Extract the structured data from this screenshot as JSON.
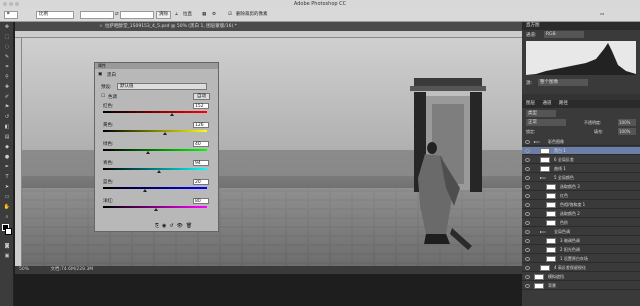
{
  "app_title": "Adobe Photoshop CC",
  "options_bar": {
    "mode_label": "比例",
    "clear_label": "清除",
    "straighten_label": "拉直",
    "delete_crop_label": "删除裁剪的像素"
  },
  "document_tab": "拉萨晒醇堂_1S09153_4_5.psd @ 50% (黑白 1, 图层蒙版/16) *",
  "status": {
    "zoom": "50%",
    "doc_size": "文档:74.6M/228.3M"
  },
  "properties": {
    "title": "属性",
    "adjust_name": "黑白",
    "preset_label": "预设:",
    "preset_value": "默认值",
    "tint_label": "色调",
    "auto_label": "自动",
    "sliders": [
      {
        "label": "红色:",
        "value": "152",
        "level": 0.66
      },
      {
        "label": "黄色:",
        "value": "126",
        "level": 0.6
      },
      {
        "label": "绿色:",
        "value": "40",
        "level": 0.43
      },
      {
        "label": "青色:",
        "value": "94",
        "level": 0.54
      },
      {
        "label": "蓝色:",
        "value": "20",
        "level": 0.4
      },
      {
        "label": "洋红:",
        "value": "80",
        "level": 0.51
      }
    ]
  },
  "histogram": {
    "title": "直方图",
    "channel_label": "通道:",
    "channel_value": "RGB",
    "source_label": "源:",
    "source_value": "整个图像"
  },
  "layers": {
    "tabs": [
      "图层",
      "通道",
      "路径"
    ],
    "kind_filter": "类型",
    "blend_mode": "正常",
    "opacity_label": "不透明度:",
    "opacity_value": "100%",
    "lock_label": "锁定:",
    "fill_label": "填充:",
    "fill_value": "100%",
    "rows": [
      {
        "name": "彩色图像",
        "indent": 0,
        "folder": true,
        "selected": false
      },
      {
        "name": "黑白 1",
        "indent": 1,
        "folder": false,
        "selected": true
      },
      {
        "name": "6 全局反差",
        "indent": 1,
        "folder": false,
        "selected": false
      },
      {
        "name": "曲线 1",
        "indent": 1,
        "folder": false,
        "selected": false
      },
      {
        "name": "5 全局颜色",
        "indent": 1,
        "folder": true,
        "selected": false
      },
      {
        "name": "选取颜色 3",
        "indent": 2,
        "folder": false,
        "selected": false
      },
      {
        "name": "红色",
        "indent": 2,
        "folder": false,
        "selected": false
      },
      {
        "name": "色相/饱和度 1",
        "indent": 2,
        "folder": false,
        "selected": false
      },
      {
        "name": "选取颜色 2",
        "indent": 2,
        "folder": false,
        "selected": false
      },
      {
        "name": "色阶",
        "indent": 2,
        "folder": false,
        "selected": false
      },
      {
        "name": "全局色调",
        "indent": 1,
        "folder": true,
        "selected": false
      },
      {
        "name": "3 暗调色调",
        "indent": 2,
        "folder": false,
        "selected": false
      },
      {
        "name": "2 阳光色调",
        "indent": 2,
        "folder": false,
        "selected": false
      },
      {
        "name": "1 设置原白灰场",
        "indent": 2,
        "folder": false,
        "selected": false
      },
      {
        "name": "4 高反差保留锐化",
        "indent": 1,
        "folder": false,
        "selected": false
      },
      {
        "name": "模拟遮挡",
        "indent": 0,
        "folder": false,
        "selected": false
      },
      {
        "name": "背景",
        "indent": 0,
        "folder": false,
        "selected": false
      }
    ]
  },
  "colors": {
    "selected_row": "#6b7fa8"
  }
}
